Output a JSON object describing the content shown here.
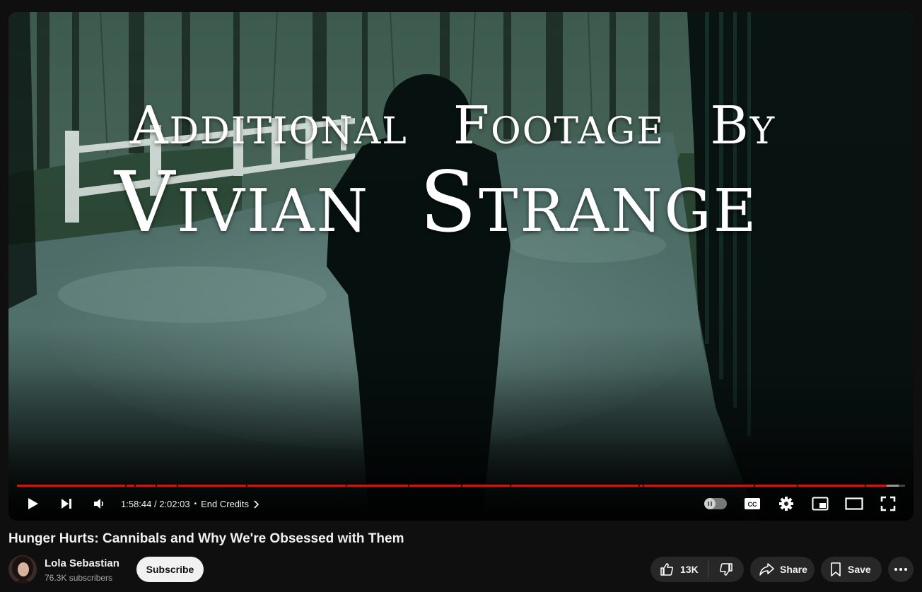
{
  "player": {
    "credit_line_1": [
      "Additional",
      "Footage",
      "By"
    ],
    "credit_line_2": [
      "Vivian",
      "Strange"
    ],
    "progress_fraction": 0.979,
    "buffered_fraction": 0.993,
    "chapter_marks_fraction": [
      0.122,
      0.132,
      0.156,
      0.18,
      0.258,
      0.37,
      0.44,
      0.5,
      0.555,
      0.7,
      0.705,
      0.83,
      0.878,
      0.955
    ],
    "current_time": "1:58:44",
    "duration": "2:02:03",
    "time_separator": " / ",
    "chapter_separator": "•",
    "chapter_title": "End Credits",
    "progress_color": "#ff0000"
  },
  "controls": {
    "play": "play-icon",
    "next": "next-icon",
    "volume": "volume-icon",
    "autoplay": "autoplay-toggle",
    "captions": "cc-icon",
    "settings": "gear-icon",
    "miniplayer": "miniplayer-icon",
    "theater": "theater-icon",
    "fullscreen": "fullscreen-icon"
  },
  "video": {
    "title": "Hunger Hurts: Cannibals and Why We're Obsessed with Them"
  },
  "channel": {
    "name": "Lola Sebastian",
    "subscribers": "76.3K subscribers",
    "subscribe_label": "Subscribe"
  },
  "actions": {
    "like_count": "13K",
    "share_label": "Share",
    "save_label": "Save"
  }
}
